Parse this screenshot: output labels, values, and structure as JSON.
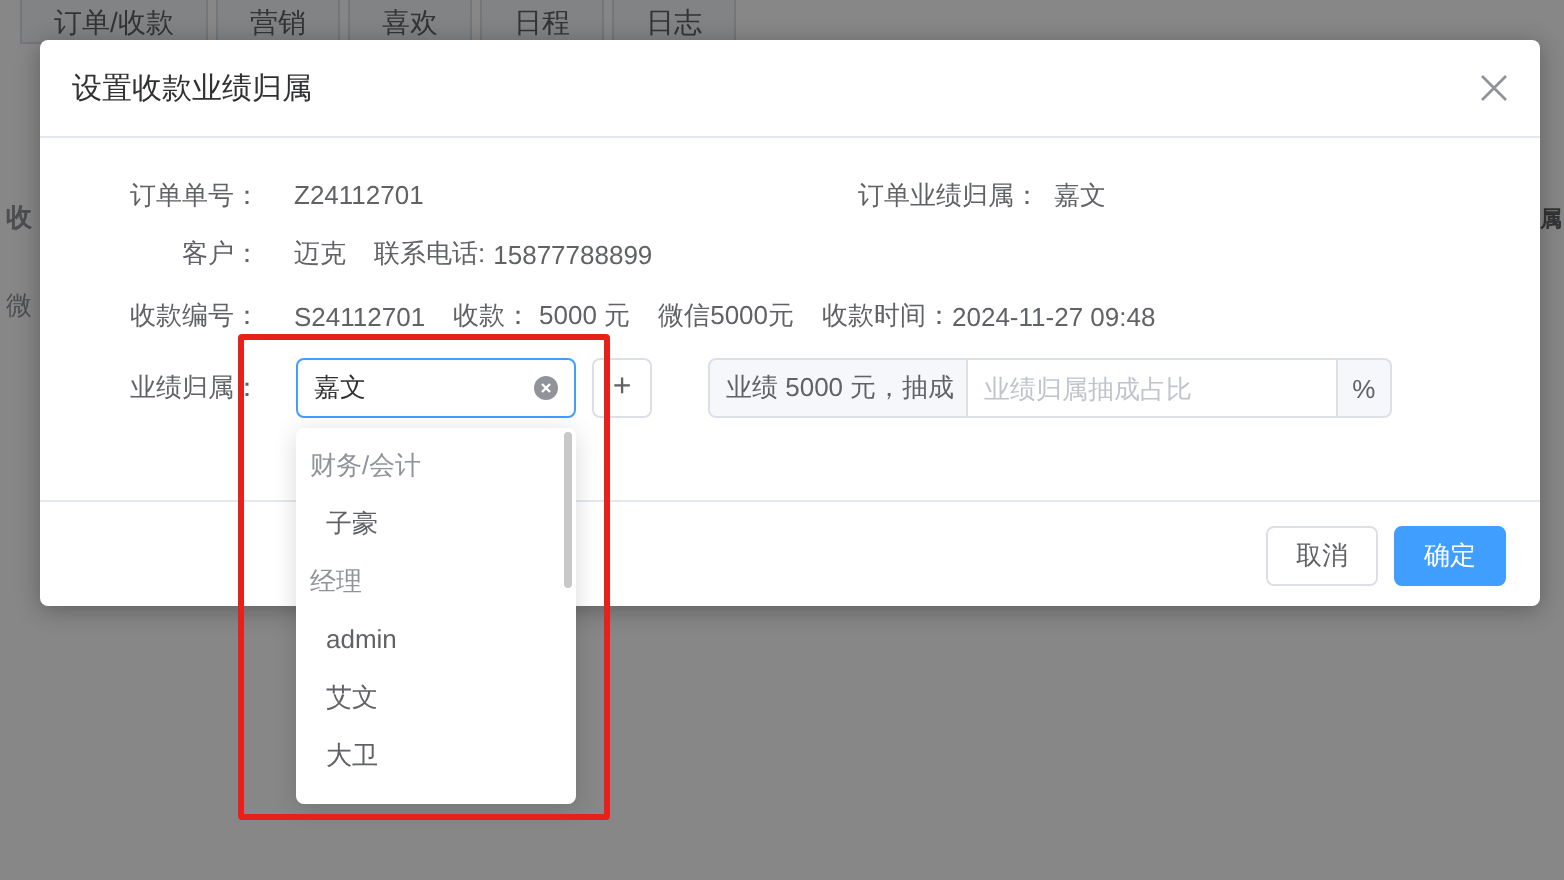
{
  "background": {
    "tabs": [
      "订单/收款",
      "营销",
      "喜欢",
      "日程",
      "日志"
    ],
    "left_fragments": [
      "收",
      "微"
    ],
    "right_fragment": "属"
  },
  "dialog": {
    "title": "设置收款业绩归属",
    "order_no": {
      "label": "订单单号：",
      "value": "Z24112701"
    },
    "order_owner": {
      "label": "订单业绩归属：",
      "value": "嘉文"
    },
    "customer": {
      "label": "客户：",
      "value": "迈克",
      "phone_label": "联系电话:",
      "phone": "15877788899"
    },
    "payment": {
      "label": "收款编号：",
      "number": "S24112701",
      "amount_label": "收款：",
      "amount": "5000 元",
      "method": "微信5000元",
      "time_label": "收款时间：",
      "time": "2024-11-27 09:48"
    },
    "owner": {
      "label": "业绩归属：",
      "select_value": "嘉文",
      "add_button": "+",
      "prefix": "业绩 5000 元，抽成",
      "placeholder": "业绩归属抽成占比",
      "suffix": "%"
    },
    "dropdown": {
      "groups": [
        {
          "label": "财务/会计",
          "options": [
            "子豪"
          ]
        },
        {
          "label": "经理",
          "options": [
            "admin",
            "艾文",
            "大卫"
          ]
        }
      ]
    },
    "buttons": {
      "cancel": "取消",
      "ok": "确定"
    }
  }
}
